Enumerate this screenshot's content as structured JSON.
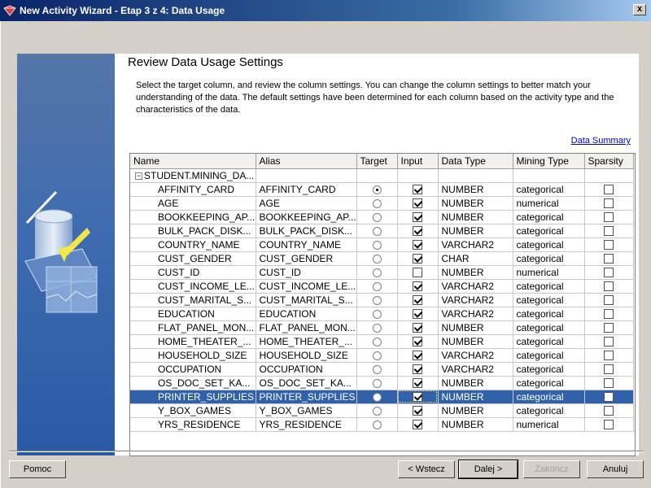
{
  "window": {
    "title": "New Activity Wizard - Etap 3 z 4: Data Usage",
    "close_label": "x"
  },
  "page": {
    "title": "Review Data Usage Settings",
    "description": "Select the target column, and review the column settings. You can change the column settings to better match your understanding of the data. The default settings have been determined for each column based on the activity type and the characteristics of the data.",
    "summary_link": "Data Summary"
  },
  "table": {
    "columns": [
      "Name",
      "Alias",
      "Target",
      "Input",
      "Data Type",
      "Mining Type",
      "Sparsity"
    ],
    "group": {
      "toggle": "−",
      "label": "STUDENT.MINING_DA..."
    },
    "rows": [
      {
        "name": "AFFINITY_CARD",
        "alias": "AFFINITY_CARD",
        "target": true,
        "input": true,
        "data_type": "NUMBER",
        "mining_type": "categorical",
        "sparsity": false
      },
      {
        "name": "AGE",
        "alias": "AGE",
        "target": false,
        "input": true,
        "data_type": "NUMBER",
        "mining_type": "numerical",
        "sparsity": false
      },
      {
        "name": "BOOKKEEPING_AP...",
        "alias": "BOOKKEEPING_AP...",
        "target": false,
        "input": true,
        "data_type": "NUMBER",
        "mining_type": "categorical",
        "sparsity": false
      },
      {
        "name": "BULK_PACK_DISK...",
        "alias": "BULK_PACK_DISK...",
        "target": false,
        "input": true,
        "data_type": "NUMBER",
        "mining_type": "categorical",
        "sparsity": false
      },
      {
        "name": "COUNTRY_NAME",
        "alias": "COUNTRY_NAME",
        "target": false,
        "input": true,
        "data_type": "VARCHAR2",
        "mining_type": "categorical",
        "sparsity": false
      },
      {
        "name": "CUST_GENDER",
        "alias": "CUST_GENDER",
        "target": false,
        "input": true,
        "data_type": "CHAR",
        "mining_type": "categorical",
        "sparsity": false
      },
      {
        "name": "CUST_ID",
        "alias": "CUST_ID",
        "target": false,
        "input": false,
        "data_type": "NUMBER",
        "mining_type": "numerical",
        "sparsity": false
      },
      {
        "name": "CUST_INCOME_LE...",
        "alias": "CUST_INCOME_LE...",
        "target": false,
        "input": true,
        "data_type": "VARCHAR2",
        "mining_type": "categorical",
        "sparsity": false
      },
      {
        "name": "CUST_MARITAL_S...",
        "alias": "CUST_MARITAL_S...",
        "target": false,
        "input": true,
        "data_type": "VARCHAR2",
        "mining_type": "categorical",
        "sparsity": false
      },
      {
        "name": "EDUCATION",
        "alias": "EDUCATION",
        "target": false,
        "input": true,
        "data_type": "VARCHAR2",
        "mining_type": "categorical",
        "sparsity": false
      },
      {
        "name": "FLAT_PANEL_MON...",
        "alias": "FLAT_PANEL_MON...",
        "target": false,
        "input": true,
        "data_type": "NUMBER",
        "mining_type": "categorical",
        "sparsity": false
      },
      {
        "name": "HOME_THEATER_...",
        "alias": "HOME_THEATER_...",
        "target": false,
        "input": true,
        "data_type": "NUMBER",
        "mining_type": "categorical",
        "sparsity": false
      },
      {
        "name": "HOUSEHOLD_SIZE",
        "alias": "HOUSEHOLD_SIZE",
        "target": false,
        "input": true,
        "data_type": "VARCHAR2",
        "mining_type": "categorical",
        "sparsity": false
      },
      {
        "name": "OCCUPATION",
        "alias": "OCCUPATION",
        "target": false,
        "input": true,
        "data_type": "VARCHAR2",
        "mining_type": "categorical",
        "sparsity": false
      },
      {
        "name": "OS_DOC_SET_KA...",
        "alias": "OS_DOC_SET_KA...",
        "target": false,
        "input": true,
        "data_type": "NUMBER",
        "mining_type": "categorical",
        "sparsity": false
      },
      {
        "name": "PRINTER_SUPPLIES",
        "alias": "PRINTER_SUPPLIES",
        "target": false,
        "input": true,
        "data_type": "NUMBER",
        "mining_type": "categorical",
        "sparsity": false,
        "selected": true
      },
      {
        "name": "Y_BOX_GAMES",
        "alias": "Y_BOX_GAMES",
        "target": false,
        "input": true,
        "data_type": "NUMBER",
        "mining_type": "categorical",
        "sparsity": false
      },
      {
        "name": "YRS_RESIDENCE",
        "alias": "YRS_RESIDENCE",
        "target": false,
        "input": true,
        "data_type": "NUMBER",
        "mining_type": "numerical",
        "sparsity": false
      }
    ]
  },
  "buttons": {
    "help": "Pomoc",
    "back": "< Wstecz",
    "next": "Dalej >",
    "finish": "Zakończ",
    "cancel": "Anuluj"
  },
  "colors": {
    "selection": "#3161a8",
    "title_bar": "#0a246a",
    "side_panel": "#3e6bb0"
  }
}
